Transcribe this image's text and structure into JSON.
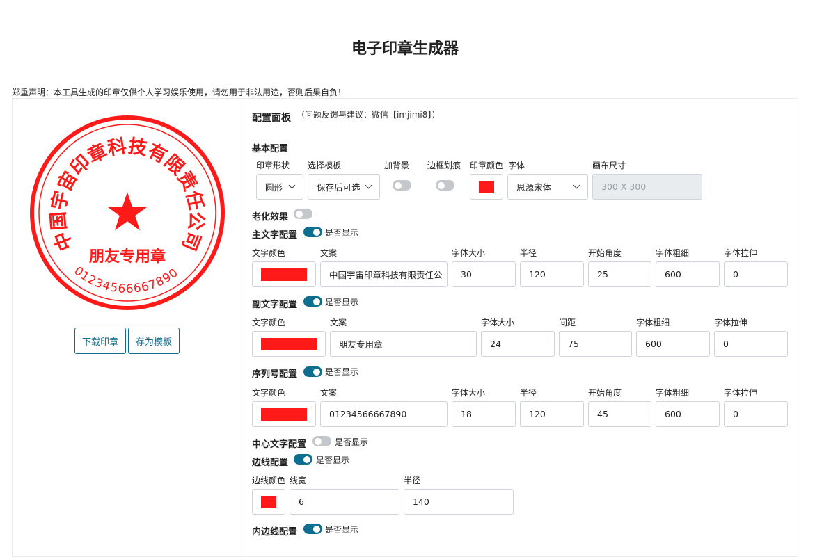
{
  "page": {
    "title": "电子印章生成器",
    "disclaimer": "郑重声明：本工具生成的印章仅供个人学习娱乐使用，请勿用于非法用途，否则后果自负！"
  },
  "seal": {
    "main_text": "中国宇宙印章科技有限责任公司",
    "sub_text": "朋友专用章",
    "serial": "01234566667890",
    "center_symbol": "★",
    "color": "#ff1a1a"
  },
  "actions": {
    "download": "下载印章",
    "save_template": "存为模板"
  },
  "panel": {
    "title": "配置面板",
    "feedback": "（问题反馈与建议：微信【imjimi8】）"
  },
  "basic": {
    "title": "基本配置",
    "labels": {
      "shape": "印章形状",
      "template": "选择模板",
      "background": "加背景",
      "border_scratch": "边框划痕",
      "color": "印章颜色",
      "font": "字体",
      "canvas": "画布尺寸"
    },
    "shape_value": "圆形",
    "template_value": "保存后可选",
    "background_on": false,
    "scratch_on": false,
    "font_value": "思源宋体",
    "canvas_placeholder": "300 X 300"
  },
  "aging": {
    "title": "老化效果",
    "on": false
  },
  "show_label": "是否显示",
  "main_text_cfg": {
    "title": "主文字配置",
    "on": true,
    "labels": [
      "文字颜色",
      "文案",
      "字体大小",
      "半径",
      "开始角度",
      "字体粗细",
      "字体拉伸"
    ],
    "values": [
      "中国宇宙印章科技有限责任公",
      "30",
      "120",
      "25",
      "600",
      "0"
    ]
  },
  "sub_text_cfg": {
    "title": "副文字配置",
    "on": true,
    "labels": [
      "文字颜色",
      "文案",
      "字体大小",
      "间距",
      "字体粗细",
      "字体拉伸"
    ],
    "values": [
      "朋友专用章",
      "24",
      "75",
      "600",
      "0"
    ]
  },
  "serial_cfg": {
    "title": "序列号配置",
    "on": true,
    "labels": [
      "文字颜色",
      "文案",
      "字体大小",
      "半径",
      "开始角度",
      "字体粗细",
      "字体拉伸"
    ],
    "values": [
      "01234566667890",
      "18",
      "120",
      "45",
      "600",
      "0"
    ]
  },
  "center_text_cfg": {
    "title": "中心文字配置",
    "on": false
  },
  "border_cfg": {
    "title": "边线配置",
    "on": true,
    "labels": [
      "边线颜色",
      "线宽",
      "半径"
    ],
    "values": [
      "6",
      "140"
    ]
  },
  "inner_border_cfg": {
    "title": "内边线配置",
    "on": true
  }
}
